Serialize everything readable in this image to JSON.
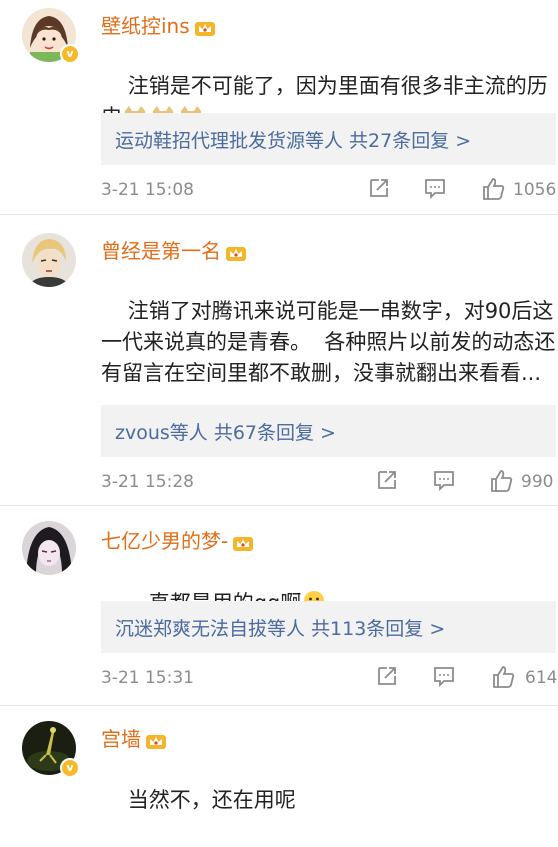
{
  "comments": [
    {
      "username": "壁纸控ins",
      "text": "注销是不可能了，因为里面有很多非主流的历史",
      "emoji_icons": [
        "doge-emoji",
        "doge-emoji",
        "doge-emoji"
      ],
      "reply_summary": "运动鞋招代理批发货源等人  共27条回复 >",
      "time": "3-21 15:08",
      "likes": "1056",
      "verified": true
    },
    {
      "username": "曾经是第一名",
      "text": "注销了对腾讯来说可能是一串数字，对90后这一代来说真的是青春。  各种照片以前发的动态还有留言在空间里都不敢删，没事就翻出来看看...",
      "reply_summary": "zvous等人  共67条回复 >",
      "time": "3-21 15:28",
      "likes": "990",
      "verified": false
    },
    {
      "username": "七亿少男的梦-",
      "text": "一直都是用的qq啊",
      "emoji_icons": [
        "thinking-emoji"
      ],
      "reply_summary": "沉迷郑爽无法自拔等人  共113条回复 >",
      "time": "3-21 15:31",
      "likes": "614",
      "verified": false
    },
    {
      "username": "宫墙",
      "text": "当然不，还在用呢",
      "verified": true
    }
  ],
  "colors": {
    "username": "#e26d18",
    "reply_link": "#4c6b9f",
    "reply_bg": "#f2f2f2",
    "meta_text": "#8c8c8c",
    "verified_badge": "#f7b928"
  },
  "icons": {
    "forward": "share-icon",
    "comment": "comment-icon",
    "like": "thumbs-up-icon",
    "crown": "vip-crown-icon"
  }
}
